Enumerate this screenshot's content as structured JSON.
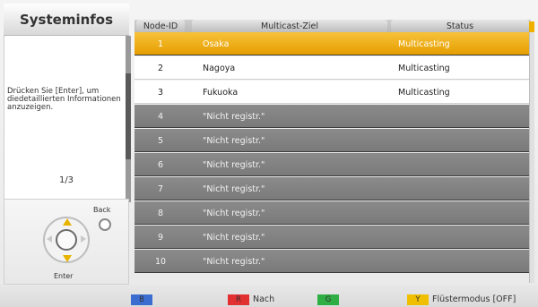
{
  "left_panel": {
    "title": "Systeminfos",
    "message": "Drücken Sie [Enter], um diedetaillierten Informationen anzuzeigen.",
    "page_indicator": "1/3"
  },
  "remote": {
    "back_label": "Back",
    "enter_label": "Enter"
  },
  "table": {
    "headers": {
      "node_id": "Node-ID",
      "target": "Multicast-Ziel",
      "status": "Status"
    },
    "rows": [
      {
        "id": "1",
        "target": "Osaka",
        "status": "Multicasting"
      },
      {
        "id": "2",
        "target": "Nagoya",
        "status": "Multicasting"
      },
      {
        "id": "3",
        "target": "Fukuoka",
        "status": "Multicasting"
      },
      {
        "id": "4",
        "target": "\"Nicht registr.\"",
        "status": ""
      },
      {
        "id": "5",
        "target": "\"Nicht registr.\"",
        "status": ""
      },
      {
        "id": "6",
        "target": "\"Nicht registr.\"",
        "status": ""
      },
      {
        "id": "7",
        "target": "\"Nicht registr.\"",
        "status": ""
      },
      {
        "id": "8",
        "target": "\"Nicht registr.\"",
        "status": ""
      },
      {
        "id": "9",
        "target": "\"Nicht registr.\"",
        "status": ""
      },
      {
        "id": "10",
        "target": "\"Nicht registr.\"",
        "status": ""
      }
    ]
  },
  "footer": {
    "keys": [
      {
        "key": "B",
        "label": ""
      },
      {
        "key": "R",
        "label": "Nach"
      },
      {
        "key": "G",
        "label": ""
      },
      {
        "key": "Y",
        "label": "Flüstermodus [OFF]"
      }
    ]
  },
  "colors": {
    "highlight": "#f0a800",
    "unregistered_row": "#7f7f7f",
    "blue_key": "#3b6dd1",
    "red_key": "#e23030",
    "green_key": "#2fae43",
    "yellow_key": "#f0c000"
  }
}
